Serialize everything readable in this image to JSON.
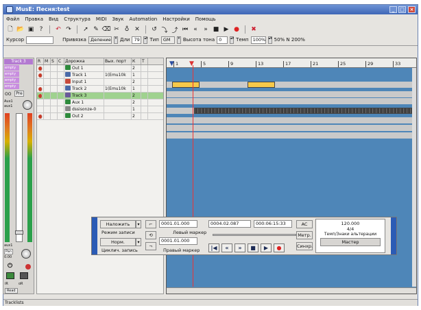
{
  "window": {
    "title": "MusE: Песня:test"
  },
  "menu": [
    "Файл",
    "Правка",
    "Вид",
    "Структура",
    "MIDI",
    "Звук",
    "Automation",
    "Настройки",
    "Помощь"
  ],
  "options": {
    "cursor_label": "Курсор",
    "snap_label": "Привязка",
    "snap_value": "Деление",
    "len_label": "Дли",
    "len_value": "79",
    "type_label": "Тип",
    "type_value": "GM",
    "pitch_label": "Высота тона",
    "pitch_value": "0",
    "tempo_label": "Темп",
    "tempo_value": "100%",
    "zoom_label": "50% N 200%"
  },
  "mixer": {
    "track_name": "Track 3",
    "routes": [
      "empty",
      "empty",
      "empty",
      "empty"
    ],
    "oo": "OO",
    "pre": "Pre",
    "aux_label": "Aux1",
    "aux_sub": "aux1",
    "pan_label": "aux1",
    "pan_value": "Pan",
    "pan_num": "0.00",
    "bottom": [
      "iR",
      "oR",
      "Read"
    ]
  },
  "tracklist": {
    "headers": [
      "R",
      "M",
      "S",
      "C",
      "Дорожка",
      "Вых. порт",
      "К",
      "T"
    ],
    "rows": [
      {
        "name": "Out 1",
        "port": "",
        "ch": "2",
        "rec": true,
        "type": "out",
        "color": "#2d8a3b"
      },
      {
        "name": "Track 1",
        "port": "1(Emu10k",
        "ch": "1",
        "rec": true,
        "type": "midi",
        "color": "#4a6aa8"
      },
      {
        "name": "Input 1",
        "port": "",
        "ch": "2",
        "rec": false,
        "type": "in",
        "color": "#c84a3a"
      },
      {
        "name": "Track 2",
        "port": "1(Emu10k",
        "ch": "1",
        "rec": true,
        "type": "midi",
        "color": "#4a6aa8"
      },
      {
        "name": "Track 3",
        "port": "",
        "ch": "2",
        "rec": true,
        "type": "wave",
        "color": "#6a5a9a"
      },
      {
        "name": "Aux 1",
        "port": "",
        "ch": "2",
        "rec": false,
        "type": "aux",
        "color": "#2d8a3b"
      },
      {
        "name": "dssisonze-0",
        "port": "",
        "ch": "1",
        "rec": false,
        "type": "synth",
        "color": "#888"
      },
      {
        "name": "Out 2",
        "port": "",
        "ch": "2",
        "rec": true,
        "type": "out",
        "color": "#2d8a3b"
      }
    ]
  },
  "ruler": {
    "marks": [
      "1",
      "5",
      "9",
      "13",
      "17",
      "21",
      "25",
      "29",
      "33"
    ]
  },
  "transport": {
    "overdub_label": "Наложить",
    "rec_mode_label": "Режим записи",
    "norm_label": "Норм.",
    "cycle_label": "Циклич. запись",
    "pos1": "0001.01.000",
    "pos2": "0004.02.087",
    "time": "000:06:15:33",
    "left_marker_pos": "0001.01.000",
    "left_marker": "Левый маркер",
    "right_marker": "Правый маркер",
    "ac": "AC",
    "metro": "Метр.",
    "sync": "Синхр.",
    "tempo": "120.000",
    "sig": "4/4",
    "tempo_label": "Темп/Знаки альтерации",
    "master": "Мастер"
  },
  "status": {
    "left": "Tracklists"
  }
}
